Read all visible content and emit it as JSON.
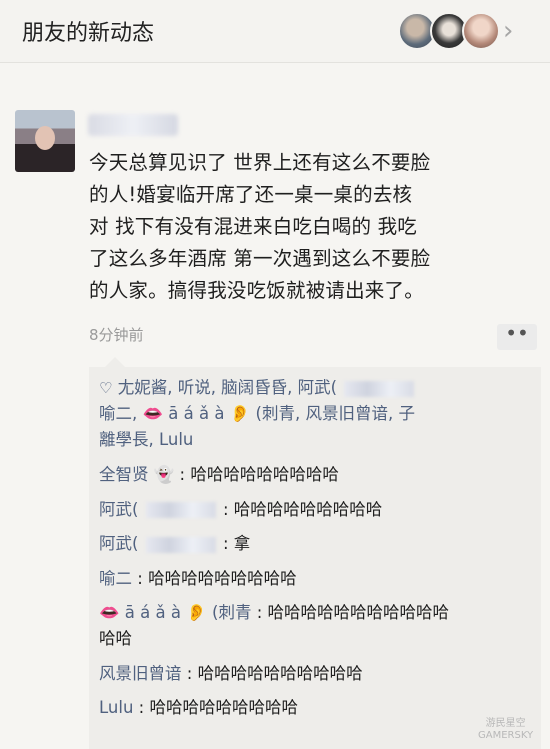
{
  "header": {
    "title": "朋友的新动态",
    "chevron": "›"
  },
  "post": {
    "text_lines": [
      "今天总算见识了 世界上还有这么不要脸",
      "的人!婚宴临开席了还一桌一桌的去核",
      "对 找下有没有混进来白吃白喝的 我吃",
      "了这么多年酒席 第一次遇到这么不要脸",
      "的人家。搞得我没吃饭就被请出来了。"
    ],
    "timestamp": "8分钟前",
    "more_icon": "••"
  },
  "likes": {
    "icon": "♡",
    "line1": "尢妮酱, 听说, 脑阔昏昏, 阿武(",
    "line2_a": "喻二, ",
    "line2_b": "ā á ǎ à",
    "line2_c": "(刺青, 风景旧曾谙, 子",
    "line3": "離學長, Lulu"
  },
  "comments": [
    {
      "author": "全智贤",
      "icon": "👻",
      "sep": ": ",
      "text": "哈哈哈哈哈哈哈哈哈"
    },
    {
      "author": "阿武(",
      "masked": true,
      "sep": ": ",
      "text": "哈哈哈哈哈哈哈哈哈"
    },
    {
      "author": "阿武(",
      "masked": true,
      "sep": ": ",
      "text": "拿"
    },
    {
      "author": "喻二",
      "sep": ": ",
      "text": "哈哈哈哈哈哈哈哈哈"
    },
    {
      "author_prefix": "ā á ǎ à",
      "author": "(刺青",
      "sep": ": ",
      "text": "哈哈哈哈哈哈哈哈哈哈哈",
      "text2": "哈哈"
    },
    {
      "author": "风景旧曾谙",
      "sep": ": ",
      "text": "哈哈哈哈哈哈哈哈哈哈"
    },
    {
      "author": "Lulu",
      "sep": ": ",
      "text": "哈哈哈哈哈哈哈哈哈"
    }
  ],
  "watermark": {
    "line1": "游民星空",
    "line2": "GAMERSKY"
  }
}
